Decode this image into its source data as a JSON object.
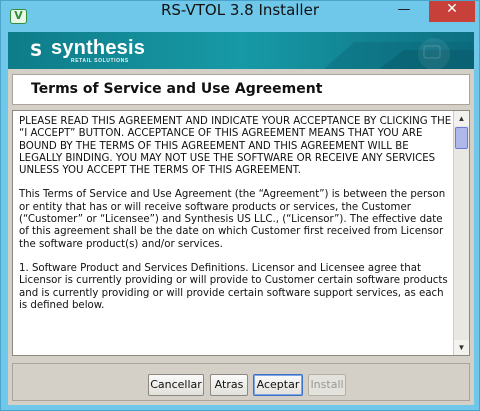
{
  "window": {
    "title": "RS-VTOL 3.8 Installer",
    "icon_letter": "V",
    "minimize_glyph": "—",
    "maximize_glyph": "☐",
    "close_glyph": "✕"
  },
  "banner": {
    "logo_mark": "S",
    "logo_text": "synthesis",
    "logo_subtext": "RETAIL SOLUTIONS"
  },
  "heading": "Terms of Service and Use Agreement",
  "agreement": {
    "paragraphs": [
      "PLEASE READ THIS AGREEMENT AND INDICATE YOUR ACCEPTANCE BY CLICKING THE “I ACCEPT” BUTTON. ACCEPTANCE OF THIS AGREEMENT MEANS THAT YOU ARE BOUND BY THE TERMS OF THIS AGREEMENT AND THIS AGREEMENT WILL BE LEGALLY BINDING. YOU MAY NOT USE THE SOFTWARE OR RECEIVE ANY SERVICES UNLESS YOU ACCEPT THE TERMS OF THIS AGREEMENT.",
      "This Terms of Service and Use Agreement (the “Agreement”) is between the person or entity that has or will receive software products or services, the Customer (“Customer” or “Licensee”) and Synthesis US LLC., (“Licensor”).    The effective date of this agreement shall be the date on which Customer first received from Licensor the software product(s) and/or services.",
      "1.      Software Product and Services Definitions.  Licensor and Licensee agree that Licensor is currently providing or will provide to Customer certain software products and is currently providing or will provide certain software support services, as each is defined below."
    ]
  },
  "buttons": {
    "cancel": "Cancellar",
    "back": "Atras",
    "accept": "Aceptar",
    "install": "Install"
  },
  "colors": {
    "titlebar": "#6fc7e9",
    "banner": "#179aa6",
    "close": "#c7403a"
  }
}
